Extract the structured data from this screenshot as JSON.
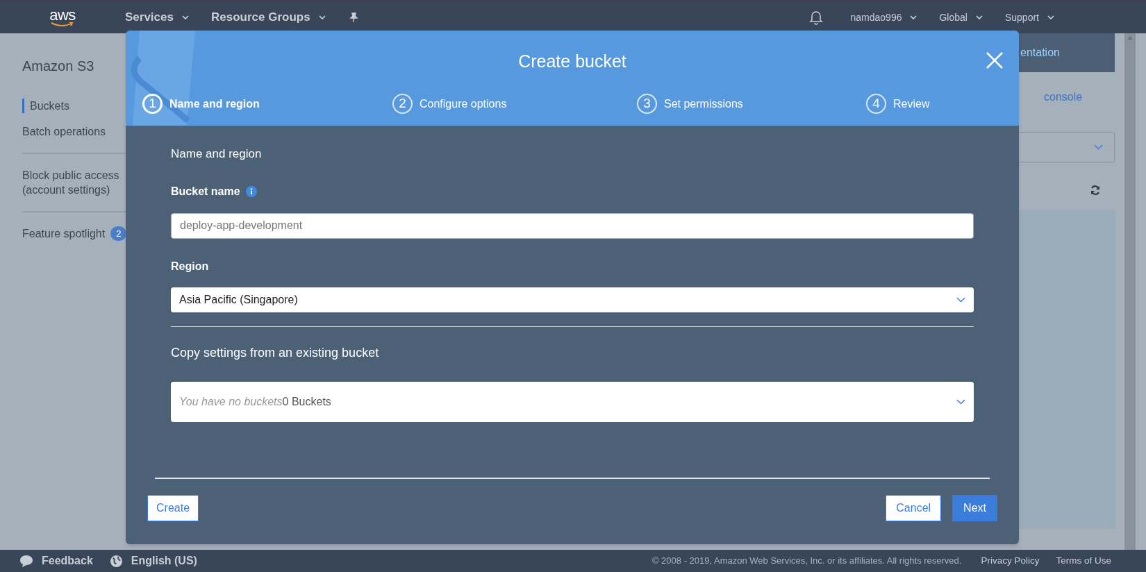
{
  "top_nav": {
    "logo": "aws",
    "menus": [
      {
        "label": "Services"
      },
      {
        "label": "Resource Groups"
      }
    ],
    "right_menus": [
      {
        "label": "namdao996"
      },
      {
        "label": "Global"
      },
      {
        "label": "Support"
      }
    ]
  },
  "sidebar": {
    "title": "Amazon S3",
    "groups": [
      [
        {
          "label": "Buckets",
          "selected": true
        },
        {
          "label": "Batch operations",
          "selected": false
        }
      ],
      [
        {
          "label": "Block public access (account settings)",
          "selected": false
        }
      ],
      [
        {
          "label": "Feature spotlight",
          "selected": false,
          "badge": "2"
        }
      ]
    ]
  },
  "background": {
    "banner": "entation",
    "link": "console"
  },
  "modal": {
    "title": "Create bucket",
    "steps": [
      {
        "number": "1",
        "label": "Name and region",
        "selected": true
      },
      {
        "number": "2",
        "label": "Configure options",
        "selected": false
      },
      {
        "number": "3",
        "label": "Set permissions",
        "selected": false
      },
      {
        "number": "4",
        "label": "Review",
        "selected": false
      }
    ],
    "section_title": "Name and region",
    "bucket_name": {
      "label": "Bucket name",
      "placeholder": "deploy-app-development"
    },
    "region": {
      "label": "Region",
      "value": "Asia Pacific (Singapore)"
    },
    "copy_section": {
      "title": "Copy settings from an existing bucket",
      "placeholder": "You have no buckets",
      "value": "0 Buckets"
    },
    "buttons": {
      "left": "Create",
      "cancel": "Cancel",
      "next": "Next"
    }
  },
  "footer": {
    "feedback": "Feedback",
    "language": "English (US)",
    "copyright": "© 2008 - 2019, Amazon Web Services, Inc. or its affiliates. All rights reserved.",
    "links": [
      "Privacy Policy",
      "Terms of Use"
    ]
  }
}
